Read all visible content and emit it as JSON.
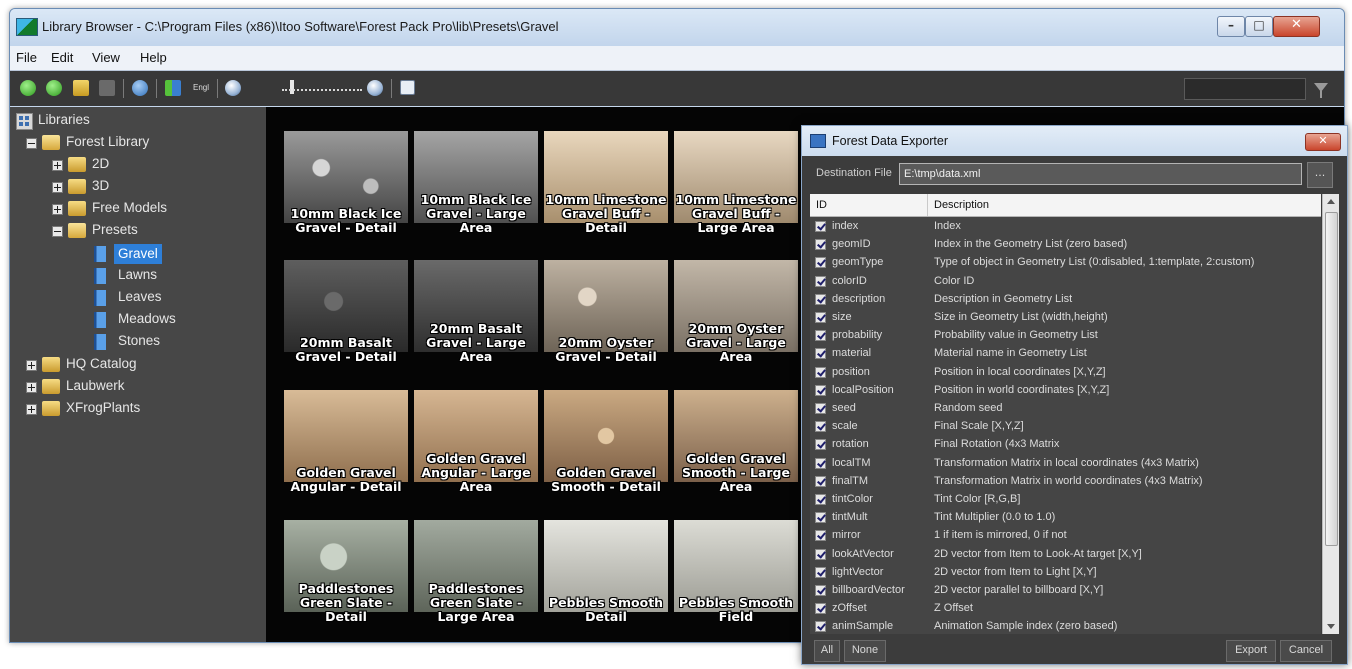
{
  "window": {
    "title": "Library Browser - C:\\Program Files (x86)\\Itoo Software\\Forest Pack Pro\\lib\\Presets\\Gravel"
  },
  "menu": [
    "File",
    "Edit",
    "View",
    "Help"
  ],
  "toolbar": {
    "engl_label": "Engl"
  },
  "tree": {
    "root": "Libraries",
    "items": [
      {
        "label": "Forest Library"
      },
      {
        "label": "2D"
      },
      {
        "label": "3D"
      },
      {
        "label": "Free Models"
      },
      {
        "label": "Presets"
      },
      {
        "label": "Gravel"
      },
      {
        "label": "Lawns"
      },
      {
        "label": "Leaves"
      },
      {
        "label": "Meadows"
      },
      {
        "label": "Stones"
      },
      {
        "label": "HQ Catalog"
      },
      {
        "label": "Laubwerk"
      },
      {
        "label": "XFrogPlants"
      }
    ]
  },
  "grid": {
    "tiles": [
      {
        "line1": "10mm Black Ice",
        "line2": "Gravel - Detail"
      },
      {
        "line1": "10mm Black Ice",
        "line2": "Gravel - Large",
        "line3": "Area"
      },
      {
        "line1": "10mm Limestone",
        "line2": "Gravel Buff -",
        "line3": "Detail"
      },
      {
        "line1": "10mm Limestone",
        "line2": "Gravel Buff -",
        "line3": "Large Area"
      },
      {
        "line1": "20mm Basalt",
        "line2": "Gravel - Detail"
      },
      {
        "line1": "20mm Basalt",
        "line2": "Gravel - Large",
        "line3": "Area"
      },
      {
        "line1": "20mm Oyster",
        "line2": "Gravel - Detail"
      },
      {
        "line1": "20mm Oyster",
        "line2": "Gravel - Large",
        "line3": "Area"
      },
      {
        "line1": "Golden Gravel",
        "line2": "Angular - Detail"
      },
      {
        "line1": "Golden Gravel",
        "line2": "Angular - Large",
        "line3": "Area"
      },
      {
        "line1": "Golden Gravel",
        "line2": "Smooth - Detail"
      },
      {
        "line1": "Golden Gravel",
        "line2": "Smooth - Large",
        "line3": "Area"
      },
      {
        "line1": "Paddlestones",
        "line2": "Green Slate -",
        "line3": "Detail"
      },
      {
        "line1": "Paddlestones",
        "line2": "Green Slate -",
        "line3": "Large Area"
      },
      {
        "line1": "Pebbles Smooth",
        "line2": "Detail"
      },
      {
        "line1": "Pebbles Smooth",
        "line2": "Field"
      }
    ]
  },
  "exporter": {
    "title": "Forest Data Exporter",
    "dest_label": "Destination File",
    "dest_value": "E:\\tmp\\data.xml",
    "browse_label": "...",
    "col_id": "ID",
    "col_desc": "Description",
    "rows": [
      {
        "id": "index",
        "desc": "Index"
      },
      {
        "id": "geomID",
        "desc": "Index in the Geometry List (zero based)"
      },
      {
        "id": "geomType",
        "desc": "Type of object in Geometry List (0:disabled, 1:template, 2:custom)"
      },
      {
        "id": "colorID",
        "desc": "Color ID"
      },
      {
        "id": "description",
        "desc": "Description in Geometry List"
      },
      {
        "id": "size",
        "desc": "Size in Geometry List (width,height)"
      },
      {
        "id": "probability",
        "desc": "Probability value in Geometry List"
      },
      {
        "id": "material",
        "desc": "Material name in Geometry List"
      },
      {
        "id": "position",
        "desc": "Position in local coordinates [X,Y,Z]"
      },
      {
        "id": "localPosition",
        "desc": "Position in world coordinates [X,Y,Z]"
      },
      {
        "id": "seed",
        "desc": "Random seed"
      },
      {
        "id": "scale",
        "desc": "Final Scale [X,Y,Z]"
      },
      {
        "id": "rotation",
        "desc": "Final Rotation (4x3 Matrix"
      },
      {
        "id": "localTM",
        "desc": "Transformation Matrix in local coordinates (4x3 Matrix)"
      },
      {
        "id": "finalTM",
        "desc": "Transformation Matrix in world coordinates (4x3 Matrix)"
      },
      {
        "id": "tintColor",
        "desc": "Tint Color [R,G,B]"
      },
      {
        "id": "tintMult",
        "desc": "Tint Multiplier (0.0 to 1.0)"
      },
      {
        "id": "mirror",
        "desc": "1 if item is mirrored, 0 if not"
      },
      {
        "id": "lookAtVector",
        "desc": "2D vector from Item to Look-At target [X,Y]"
      },
      {
        "id": "lightVector",
        "desc": "2D vector from Item to Light [X,Y]"
      },
      {
        "id": "billboardVector",
        "desc": "2D vector parallel to billboard [X,Y]"
      },
      {
        "id": "zOffset",
        "desc": "Z Offset"
      },
      {
        "id": "animSample",
        "desc": "Animation Sample index (zero based)"
      }
    ],
    "btn_all": "All",
    "btn_none": "None",
    "btn_export": "Export",
    "btn_cancel": "Cancel"
  }
}
